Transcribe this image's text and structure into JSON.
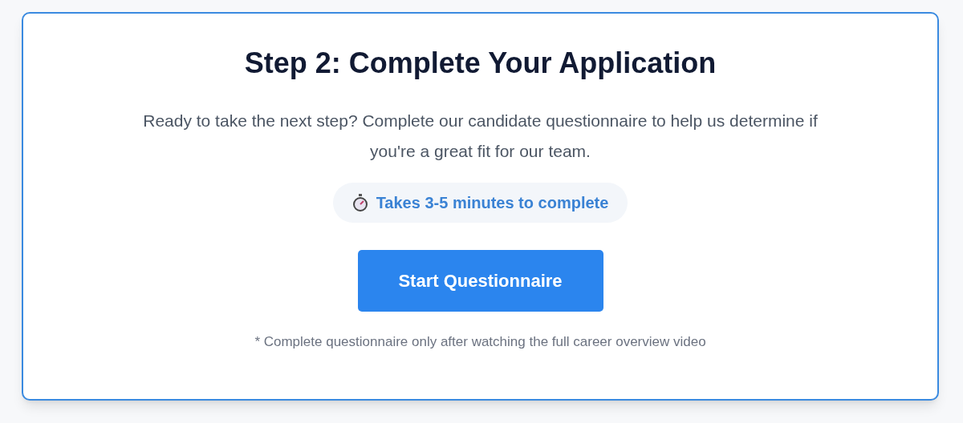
{
  "title": "Step 2: Complete Your Application",
  "description": "Ready to take the next step? Complete our candidate questionnaire to help us determine if you're a great fit for our team.",
  "duration_badge": "Takes 3-5 minutes to complete",
  "start_button": "Start Questionnaire",
  "footnote": "* Complete questionnaire only after watching the full career overview video"
}
